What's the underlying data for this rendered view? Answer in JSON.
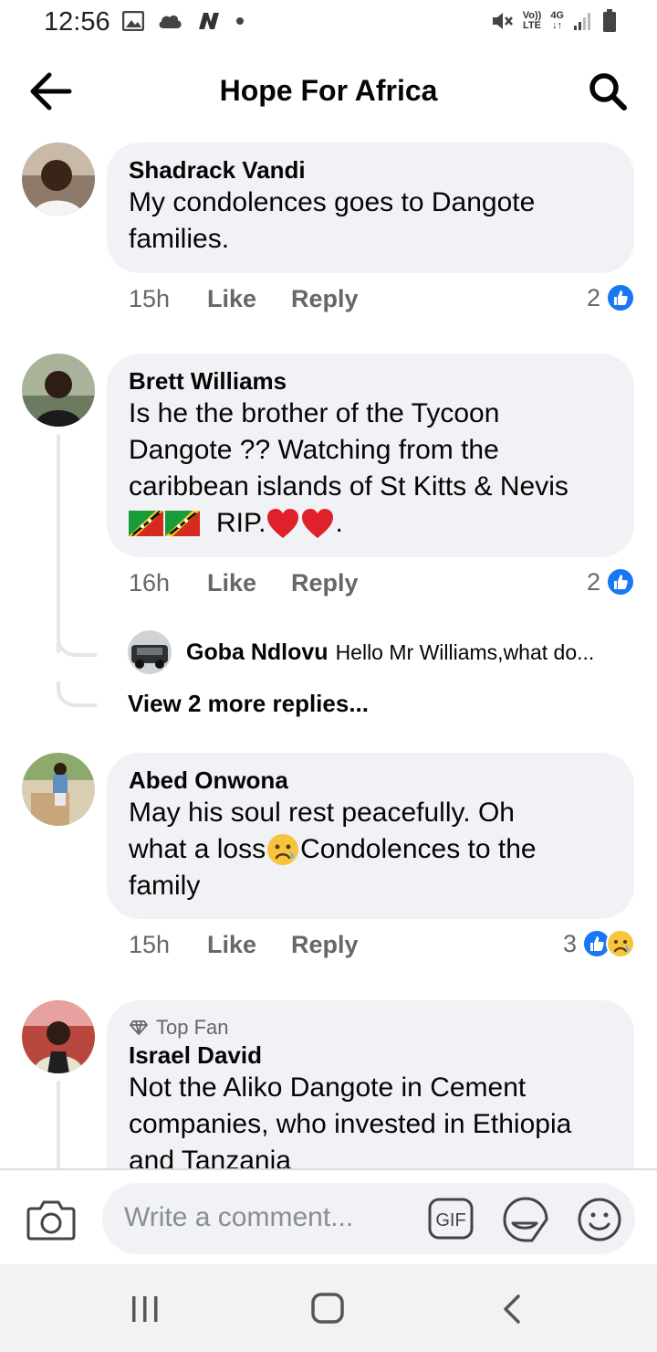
{
  "status_bar": {
    "time": "12:56",
    "volte_top": "Vo))",
    "volte_bottom": "LTE",
    "network_top": "4G",
    "network_bottom": "↓↑",
    "icons": [
      "image-icon",
      "cloud-icon",
      "n-app-icon",
      "dot-icon",
      "mute-icon",
      "signal-icon",
      "battery-icon"
    ]
  },
  "header": {
    "title": "Hope For Africa"
  },
  "comments": [
    {
      "author": "Shadrack Vandi",
      "lines": [
        "My condolences goes to Dangote",
        "families."
      ],
      "time": "15h",
      "like": "Like",
      "reply": "Reply",
      "reaction_count": "2"
    },
    {
      "author": "Brett Williams",
      "lines": [
        "Is he the brother of the Tycoon",
        "Dangote ?? Watching from the",
        "caribbean islands of St Kitts & Nevis"
      ],
      "last_line_text": "RIP.",
      "last_line_end": ".",
      "time": "16h",
      "like": "Like",
      "reply": "Reply",
      "reaction_count": "2",
      "reply_preview": {
        "author": "Goba Ndlovu",
        "text": "Hello Mr Williams,what do..."
      },
      "view_more": "View 2 more replies..."
    },
    {
      "author": "Abed Onwona",
      "lines": [
        "May his soul rest peacefully.  Oh",
        "what a loss",
        "family"
      ],
      "line2_after": " Condolences to the",
      "time": "15h",
      "like": "Like",
      "reply": "Reply",
      "reaction_count": "3"
    },
    {
      "badge": "Top Fan",
      "author": "Israel David",
      "lines": [
        "Not the Aliko Dangote in Cement",
        "companies, who invested in Ethiopia",
        "and Tanzania"
      ]
    }
  ],
  "composer": {
    "placeholder": "Write a comment...",
    "gif_label": "GIF"
  },
  "colors": {
    "accent_blue": "#1877f2",
    "bubble_bg": "#f0f2f5",
    "meta_gray": "#65676b",
    "heart_red": "#e0202a"
  }
}
